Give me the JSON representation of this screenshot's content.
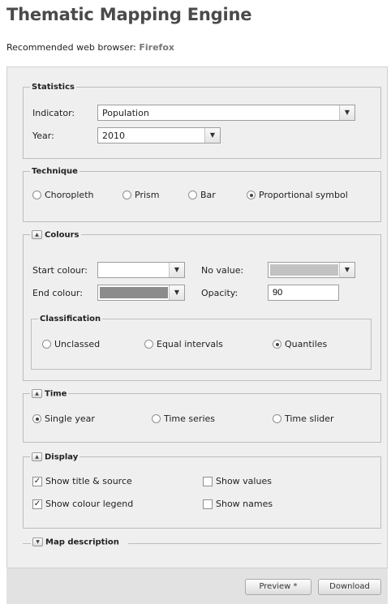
{
  "header": {
    "title": "Thematic Mapping Engine",
    "browser_label": "Recommended web browser:",
    "browser_value": "Firefox"
  },
  "statistics": {
    "legend": "Statistics",
    "indicator_label": "Indicator:",
    "indicator_value": "Population",
    "year_label": "Year:",
    "year_value": "2010"
  },
  "technique": {
    "legend": "Technique",
    "options": [
      "Choropleth",
      "Prism",
      "Bar",
      "Proportional symbol"
    ],
    "selected": "Proportional symbol"
  },
  "colours": {
    "legend": "Colours",
    "start_label": "Start colour:",
    "start_color": "#ffffff",
    "end_label": "End colour:",
    "end_color": "#8c8c8c",
    "novalue_label": "No value:",
    "novalue_color": "#c2c2c2",
    "opacity_label": "Opacity:",
    "opacity_value": "90",
    "classification": {
      "legend": "Classification",
      "options": [
        "Unclassed",
        "Equal intervals",
        "Quantiles"
      ],
      "selected": "Quantiles"
    }
  },
  "time": {
    "legend": "Time",
    "options": [
      "Single year",
      "Time series",
      "Time slider"
    ],
    "selected": "Single year"
  },
  "display": {
    "legend": "Display",
    "show_title_source": "Show title & source",
    "show_title_source_checked": true,
    "show_colour_legend": "Show colour legend",
    "show_colour_legend_checked": true,
    "show_values": "Show values",
    "show_values_checked": false,
    "show_names": "Show names",
    "show_names_checked": false
  },
  "map_description": {
    "legend": "Map description"
  },
  "footer": {
    "preview_label": "Preview *",
    "download_label": "Download"
  }
}
